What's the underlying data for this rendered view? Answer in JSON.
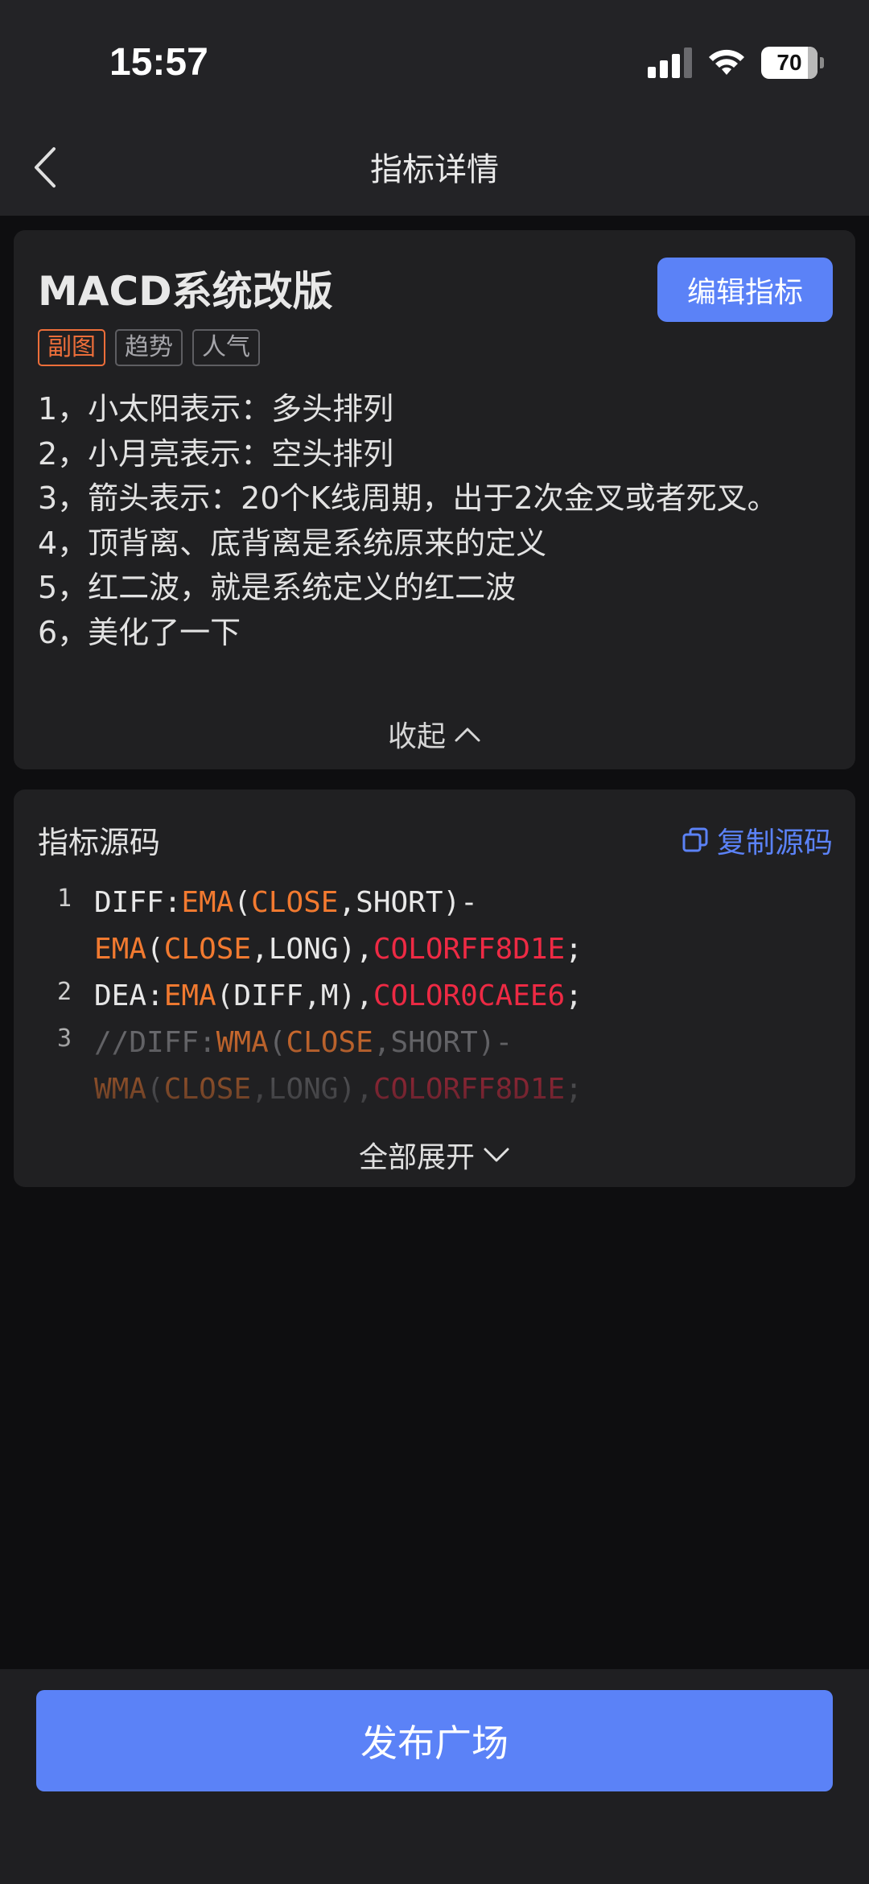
{
  "status_bar": {
    "time": "15:57",
    "battery": "70"
  },
  "nav": {
    "title": "指标详情"
  },
  "indicator": {
    "name": "MACD系统改版",
    "edit_label": "编辑指标",
    "tags": [
      "副图",
      "趋势",
      "人气"
    ],
    "description": [
      "1，小太阳表示：多头排列",
      "2，小月亮表示：空头排列",
      "3，箭头表示：20个K线周期，出于2次金叉或者死叉。",
      "4，顶背离、底背离是系统原来的定义",
      "5，红二波，就是系统定义的红二波",
      "6，美化了一下"
    ],
    "collapse_label": "收起"
  },
  "source": {
    "title": "指标源码",
    "copy_label": "复制源码",
    "line_numbers": [
      "1",
      "2",
      "3"
    ],
    "code": {
      "l1a": "DIFF:",
      "l1b": "EMA",
      "l1c": "(",
      "l1d": "CLOSE",
      "l1e": ",SHORT)-",
      "l1f": "EMA",
      "l1g": "(",
      "l1h": "CLOSE",
      "l1i": ",LONG),",
      "l1j": "COLORFF8D1E",
      "l1k": ";",
      "l2a": "DEA:",
      "l2b": "EMA",
      "l2c": "(DIFF,M),",
      "l2d": "COLOR0CAEE6",
      "l2e": ";",
      "l3a": "//DIFF:",
      "l3b": "WMA",
      "l3c": "(",
      "l3d": "CLOSE",
      "l3e": ",SHORT)-",
      "l3f": "WMA",
      "l3g": "(",
      "l3h": "CLOSE",
      "l3i": ",LONG),",
      "l3j": "COLORFF8D1E",
      "l3k": ";"
    },
    "expand_label": "全部展开"
  },
  "footer": {
    "publish_label": "发布广场"
  },
  "colors": {
    "accent": "#5b82f7",
    "tag_hot": "#ed6e3a",
    "keyword": "#f27a30",
    "color_const": "#ee2a44"
  },
  "icons": {
    "back": "chevron-left-icon",
    "collapse": "chevron-up-icon",
    "expand": "chevron-down-icon",
    "copy": "copy-icon"
  }
}
